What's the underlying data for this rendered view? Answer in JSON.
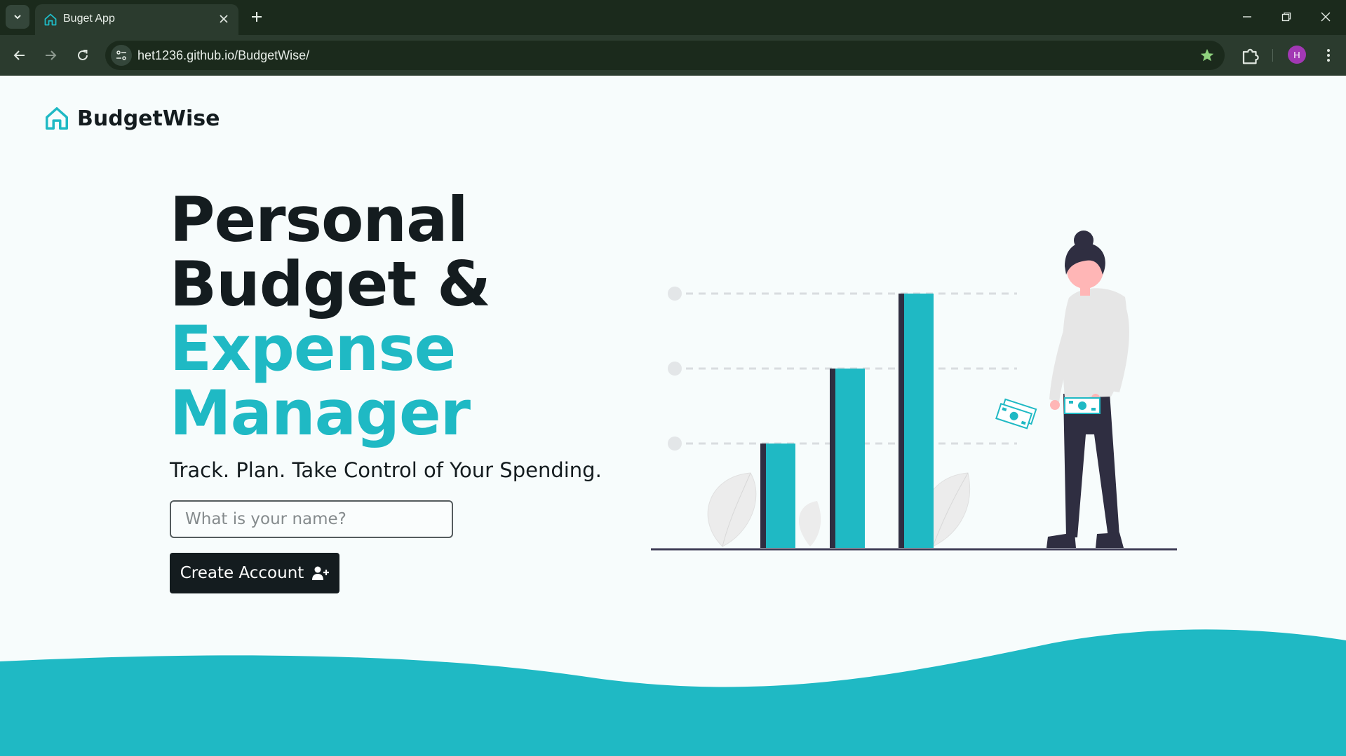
{
  "browser": {
    "tab_title": "Buget App",
    "url": "het1236.github.io/BudgetWise/",
    "profile_initial": "H"
  },
  "brand": {
    "name": "BudgetWise"
  },
  "hero": {
    "line1": "Personal",
    "line2": "Budget &",
    "line3": "Expense",
    "line4": "Manager",
    "tagline": "Track. Plan. Take Control of Your Spending."
  },
  "form": {
    "name_placeholder": "What is your name?",
    "create_label": "Create Account"
  },
  "colors": {
    "accent": "#1fb9c4",
    "dark": "#141c1f",
    "background": "#f7fcfc"
  }
}
